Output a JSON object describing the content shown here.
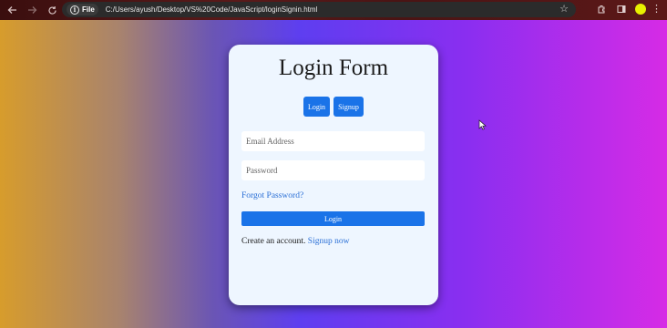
{
  "browser": {
    "chip_label": "File",
    "url": "C:/Users/ayush/Desktop/VS%20Code/JavaScript/loginSignin.html",
    "accent_colors": {
      "profile": "#e8f000"
    }
  },
  "form": {
    "title": "Login Form",
    "tabs": {
      "login": "Login",
      "signup": "Signup"
    },
    "email_placeholder": "Email Address",
    "password_placeholder": "Password",
    "forgot": "Forgot Password?",
    "submit": "Login",
    "signup_prompt": "Create an account.",
    "signup_link": "Signup now"
  },
  "colors": {
    "primary": "#1a73e8",
    "card": "#eef6ff",
    "link": "#2a6fd6"
  }
}
